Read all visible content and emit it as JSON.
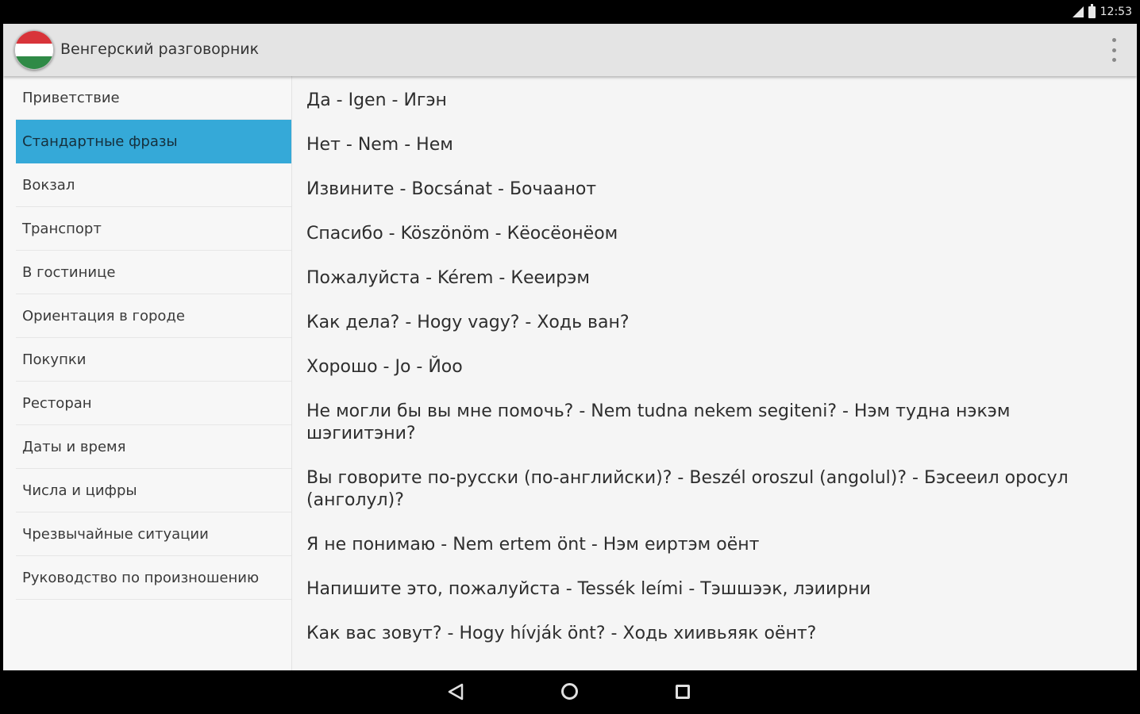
{
  "status_bar": {
    "time": "12:53",
    "icons": [
      "signal-icon",
      "battery-icon"
    ]
  },
  "action_bar": {
    "title": "Венгерский разговорник",
    "logo_icon": "hungary-flag-icon",
    "menu_icon": "overflow-menu-icon",
    "flag_colors": [
      "#d8343a",
      "#ffffff",
      "#2f8a46"
    ]
  },
  "sidebar": {
    "selected_index": 1,
    "accent_color": "#35a9d8",
    "items": [
      {
        "label": "Приветствие"
      },
      {
        "label": "Стандартные фразы"
      },
      {
        "label": "Вокзал"
      },
      {
        "label": "Транспорт"
      },
      {
        "label": "В гостинице"
      },
      {
        "label": "Ориентация в городе"
      },
      {
        "label": "Покупки"
      },
      {
        "label": "Ресторан"
      },
      {
        "label": "Даты и время"
      },
      {
        "label": "Числа и цифры"
      },
      {
        "label": "Чрезвычайные ситуации"
      },
      {
        "label": "Руководство по произношению"
      }
    ]
  },
  "phrases": [
    {
      "text": "Да - Igen - Игэн"
    },
    {
      "text": "Нет - Nem - Нем"
    },
    {
      "text": "Извините - Bocsánat - Бочаанот"
    },
    {
      "text": "Спасибо - Köszönöm - Кёосёонёом"
    },
    {
      "text": "Пожалуйста - Kérem - Кееирэм"
    },
    {
      "text": "Как дела? - Hogy vagy? - Ходь ван?"
    },
    {
      "text": "Хорошо - Jo - Йоо"
    },
    {
      "text": "Не могли бы вы мне помочь? - Nem tudna nekem segiteni? - Нэм тудна нэкэм шэгиитэни?"
    },
    {
      "text": "Вы говорите по-русски (по-английски)? - Beszél oroszul (angolul)? - Бэсеeил оросул (анголул)?"
    },
    {
      "text": "Я не понимаю - Nem ertem önt - Нэм еиртэм оёнт"
    },
    {
      "text": "Напишите это, пожалуйста - Tessék leími - Тэшшээк, лэиирни"
    },
    {
      "text": "Как вас зовут? - Hogy hívják önt? - Ходь хиивьяяк оёнт?"
    }
  ],
  "nav_bar": {
    "icons": [
      "back-icon",
      "home-icon",
      "recents-icon"
    ]
  }
}
